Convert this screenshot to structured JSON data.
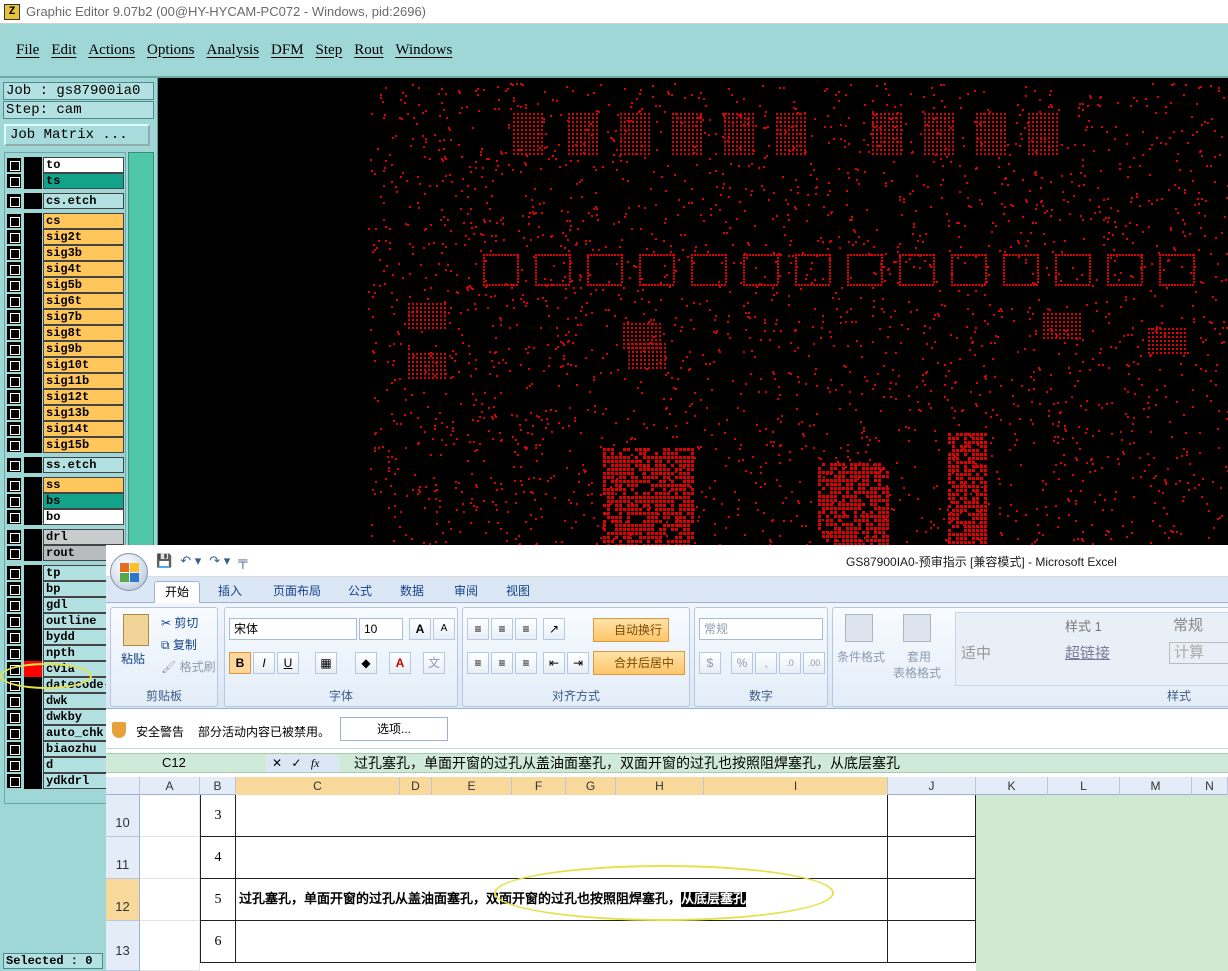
{
  "ge": {
    "title": "Graphic Editor 9.07b2 (00@HY-HYCAM-PC072 - Windows, pid:2696)",
    "menu": [
      "File",
      "Edit",
      "Actions",
      "Options",
      "Analysis",
      "DFM",
      "Step",
      "Rout",
      "Windows"
    ],
    "job": "Job : gs87900ia0",
    "step": "Step: cam",
    "job_matrix": "Job Matrix ...",
    "selected": "Selected : 0",
    "layers": [
      {
        "name": "to",
        "color": "white"
      },
      {
        "name": "ts",
        "color": "green"
      },
      {
        "name": "cs.etch",
        "color": "cyan"
      },
      {
        "name": "cs",
        "color": "orange"
      },
      {
        "name": "sig2t",
        "color": "orange"
      },
      {
        "name": "sig3b",
        "color": "orange"
      },
      {
        "name": "sig4t",
        "color": "orange"
      },
      {
        "name": "sig5b",
        "color": "orange"
      },
      {
        "name": "sig6t",
        "color": "orange"
      },
      {
        "name": "sig7b",
        "color": "orange"
      },
      {
        "name": "sig8t",
        "color": "orange"
      },
      {
        "name": "sig9b",
        "color": "orange"
      },
      {
        "name": "sig10t",
        "color": "orange"
      },
      {
        "name": "sig11b",
        "color": "orange"
      },
      {
        "name": "sig12t",
        "color": "orange"
      },
      {
        "name": "sig13b",
        "color": "orange"
      },
      {
        "name": "sig14t",
        "color": "orange"
      },
      {
        "name": "sig15b",
        "color": "orange"
      },
      {
        "name": "ss.etch",
        "color": "cyan"
      },
      {
        "name": "ss",
        "color": "orange"
      },
      {
        "name": "bs",
        "color": "green"
      },
      {
        "name": "bo",
        "color": "white"
      },
      {
        "name": "drl",
        "color": "drl"
      },
      {
        "name": "rout",
        "color": "gray"
      },
      {
        "name": "tp",
        "color": "cyan"
      },
      {
        "name": "bp",
        "color": "cyan"
      },
      {
        "name": "gdl",
        "color": "cyan"
      },
      {
        "name": "outline",
        "color": "cyan"
      },
      {
        "name": "bydd",
        "color": "cyan"
      },
      {
        "name": "npth",
        "color": "cyan"
      },
      {
        "name": "cvia",
        "color": "cyan",
        "active": true
      },
      {
        "name": "datecode-",
        "color": "cyan"
      },
      {
        "name": "dwk",
        "color": "cyan"
      },
      {
        "name": "dwkby",
        "color": "cyan"
      },
      {
        "name": "auto_chk",
        "color": "cyan"
      },
      {
        "name": "biaozhu",
        "color": "cyan"
      },
      {
        "name": "d",
        "color": "cyan"
      },
      {
        "name": "ydkdrl",
        "color": "cyan"
      }
    ],
    "active_layer_color": "#ff0000",
    "canvas_feature_color": "#e00000"
  },
  "xl": {
    "title": "GS87900IA0-预审指示  [兼容模式] - Microsoft Excel",
    "qat": [
      "💾",
      "↶ ▾",
      "↷ ▾",
      "╤"
    ],
    "tabs": [
      "开始",
      "插入",
      "页面布局",
      "公式",
      "数据",
      "审阅",
      "视图"
    ],
    "ribbon": {
      "clipboard": {
        "label": "剪贴板",
        "paste": "粘贴",
        "cut": "剪切",
        "copy": "复制",
        "format_painter": "格式刷"
      },
      "font": {
        "label": "字体",
        "name": "宋体",
        "size": "10",
        "bold": "B",
        "italic": "I",
        "underline": "U",
        "grow": "A",
        "shrink": "A"
      },
      "alignment": {
        "label": "对齐方式",
        "wrap": "自动换行",
        "merge": "合并后居中"
      },
      "number": {
        "label": "数字",
        "format": "常规",
        "percent": "%",
        "comma": ","
      },
      "styles": {
        "label": "样式",
        "cond": "条件格式",
        "table1": "套用",
        "table2": "表格格式",
        "style1": "样式 1",
        "normal": "常规",
        "middle": "适中",
        "hyperlink": "超链接",
        "calc": "计算"
      }
    },
    "security": {
      "title": "安全警告",
      "message": "部分活动内容已被禁用。",
      "options": "选项..."
    },
    "namebox": "C12",
    "formula": "过孔塞孔，单面开窗的过孔从盖油面塞孔，双面开窗的过孔也按照阻焊塞孔，从底层塞孔",
    "columns": [
      "A",
      "B",
      "C",
      "D",
      "E",
      "F",
      "G",
      "H",
      "I",
      "J",
      "K",
      "L",
      "M",
      "N"
    ],
    "rows": [
      {
        "num": "10",
        "b": "3",
        "c_normal": "",
        "c_highlight": ""
      },
      {
        "num": "11",
        "b": "4",
        "c_normal": "",
        "c_highlight": ""
      },
      {
        "num": "12",
        "b": "5",
        "c_normal": "过孔塞孔，单面开窗的过孔从盖油面塞孔，双面开窗的过孔也按照阻焊塞孔，",
        "c_highlight": "从底层塞孔"
      },
      {
        "num": "13",
        "b": "6",
        "c_normal": "",
        "c_highlight": ""
      }
    ]
  }
}
